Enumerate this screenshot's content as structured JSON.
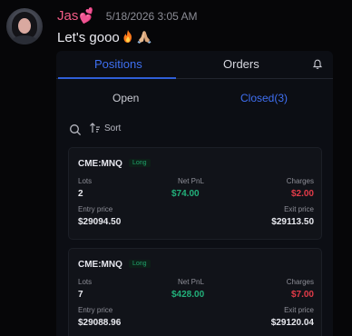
{
  "message": {
    "username": "Jas",
    "username_emoji": "💕",
    "timestamp": "5/18/2026 3:05 AM",
    "text": "Let's gooo",
    "emojis": [
      "fire-emoji",
      "pray-emoji"
    ]
  },
  "app": {
    "tabs": [
      {
        "label": "Positions",
        "active": true
      },
      {
        "label": "Orders",
        "active": false
      }
    ],
    "subtabs": [
      {
        "label": "Open",
        "active": false
      },
      {
        "label": "Closed(3)",
        "active": true
      }
    ],
    "sort_label": "Sort",
    "colors": {
      "accent": "#2f5fd8",
      "profit": "#22b07a",
      "charges": "#e23b48",
      "username": "#f25b86"
    },
    "labels": {
      "lots": "Lots",
      "net_pnl": "Net PnL",
      "charges": "Charges",
      "entry_price": "Entry price",
      "exit_price": "Exit price"
    },
    "positions": [
      {
        "symbol": "CME:MNQ",
        "side": "Long",
        "lots": "2",
        "net_pnl": "$74.00",
        "charges": "$2.00",
        "entry_price": "$29094.50",
        "exit_price": "$29113.50"
      },
      {
        "symbol": "CME:MNQ",
        "side": "Long",
        "lots": "7",
        "net_pnl": "$428.00",
        "charges": "$7.00",
        "entry_price": "$29088.96",
        "exit_price": "$29120.04"
      }
    ]
  }
}
